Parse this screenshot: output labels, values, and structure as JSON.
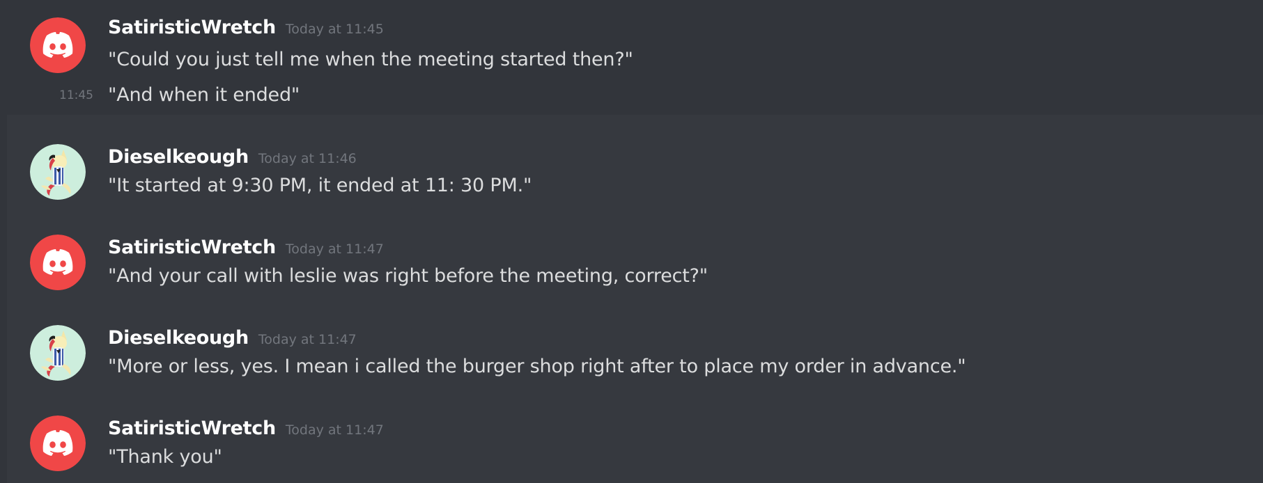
{
  "colors": {
    "background": "#36393f",
    "hover_background": "#32353b",
    "username": "#ffffff",
    "timestamp": "#72767d",
    "message_text": "#dcddde",
    "discord_avatar_red": "#f04747"
  },
  "messages": [
    {
      "author": "SatiristicWretch",
      "avatar": "discord-logo-red",
      "timestamp": "Today at 11:45",
      "lines": [
        "\"Could you just tell me when the meeting started then?\""
      ],
      "continuation": {
        "time": "11:45",
        "text": "\"And when it ended\""
      }
    },
    {
      "author": "Dieselkeough",
      "avatar": "pony-character",
      "timestamp": "Today at 11:46",
      "lines": [
        "\"It started at 9:30 PM, it ended at 11: 30 PM.\""
      ]
    },
    {
      "author": "SatiristicWretch",
      "avatar": "discord-logo-red",
      "timestamp": "Today at 11:47",
      "lines": [
        "\"And your call with leslie was right before the meeting, correct?\""
      ]
    },
    {
      "author": "Dieselkeough",
      "avatar": "pony-character",
      "timestamp": "Today at 11:47",
      "lines": [
        "\"More or less, yes. I mean i called the burger shop right after to place my order in advance.\""
      ]
    },
    {
      "author": "SatiristicWretch",
      "avatar": "discord-logo-red",
      "timestamp": "Today at 11:47",
      "lines": [
        "\"Thank you\""
      ]
    }
  ]
}
